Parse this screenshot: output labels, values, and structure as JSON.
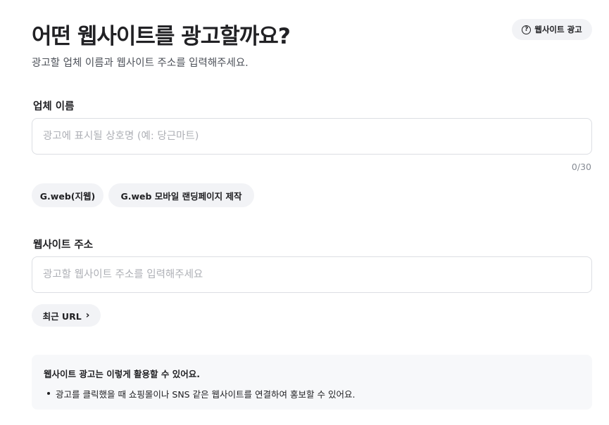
{
  "header": {
    "title": "어떤 웹사이트를 광고할까요?",
    "subtitle": "광고할 업체 이름과 웹사이트 주소를 입력해주세요.",
    "help_button": {
      "icon": "question-circle-icon",
      "label": "웹사이트 광고"
    }
  },
  "company": {
    "label": "업체 이름",
    "placeholder": "광고에 표시될 상호명 (예: 당근마트)",
    "value": "",
    "counter": "0/30",
    "suggestions": [
      "G.web(지웹)",
      "G.web 모바일 랜딩페이지 제작"
    ]
  },
  "website": {
    "label": "웹사이트 주소",
    "placeholder": "광고할 웹사이트 주소를 입력해주세요",
    "value": "",
    "recent_button": {
      "label": "최근 URL",
      "icon": "chevron-right-icon"
    }
  },
  "info": {
    "title": "웹사이트 광고는 이렇게 활용할 수 있어요.",
    "items": [
      "광고를 클릭했을 때 쇼핑몰이나 SNS 같은 웹사이트를 연결하여 홍보할 수 있어요."
    ]
  }
}
